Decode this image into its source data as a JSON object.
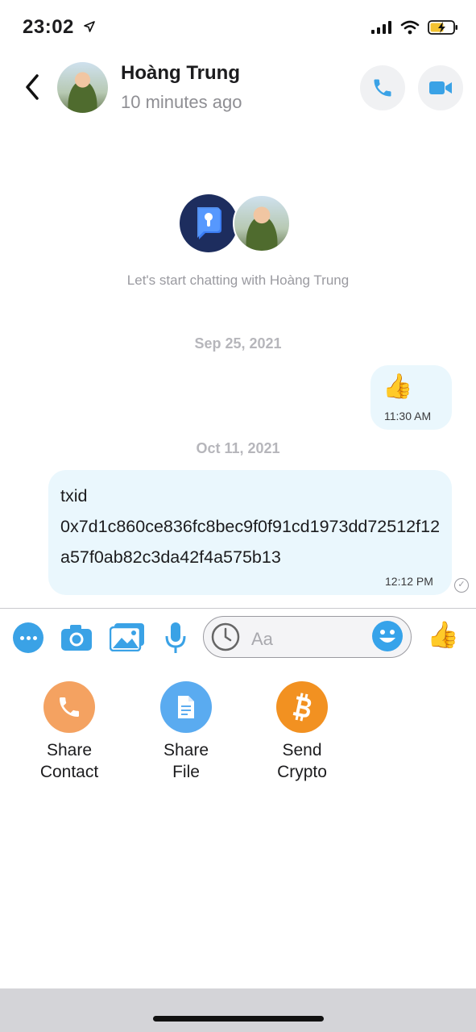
{
  "status_bar": {
    "time": "23:02"
  },
  "header": {
    "contact_name": "Hoàng Trung",
    "contact_status": "10 minutes ago",
    "icons": {
      "back": "chevron-left-icon",
      "call": "phone-icon",
      "video": "video-camera-icon"
    },
    "accent_color": "#3aa2e6"
  },
  "intro": {
    "text": "Let's start chatting with Hoàng Trung"
  },
  "messages": [
    {
      "date": "Sep 25, 2021",
      "direction": "outgoing",
      "content": "👍",
      "time": "11:30 AM"
    },
    {
      "date": "Oct 11, 2021",
      "direction": "incoming",
      "content": "txid\n0x7d1c860ce836fc8bec9f0f91cd1973dd72512f12a57f0ab82c3da42f4a575b13",
      "time": "12:12 PM"
    }
  ],
  "composer": {
    "placeholder": "Aa",
    "like": "👍",
    "icons": [
      "more-icon",
      "camera-icon",
      "gallery-icon",
      "microphone-icon",
      "clock-icon",
      "smiley-icon",
      "thumbs-up-icon"
    ]
  },
  "share_actions": [
    {
      "label": "Share\nContact",
      "icon": "phone-icon",
      "color": "#f4a261"
    },
    {
      "label": "Share\nFile",
      "icon": "file-icon",
      "color": "#5aabf0"
    },
    {
      "label": "Send\nCrypto",
      "icon": "bitcoin-icon",
      "color": "#f29121"
    }
  ]
}
